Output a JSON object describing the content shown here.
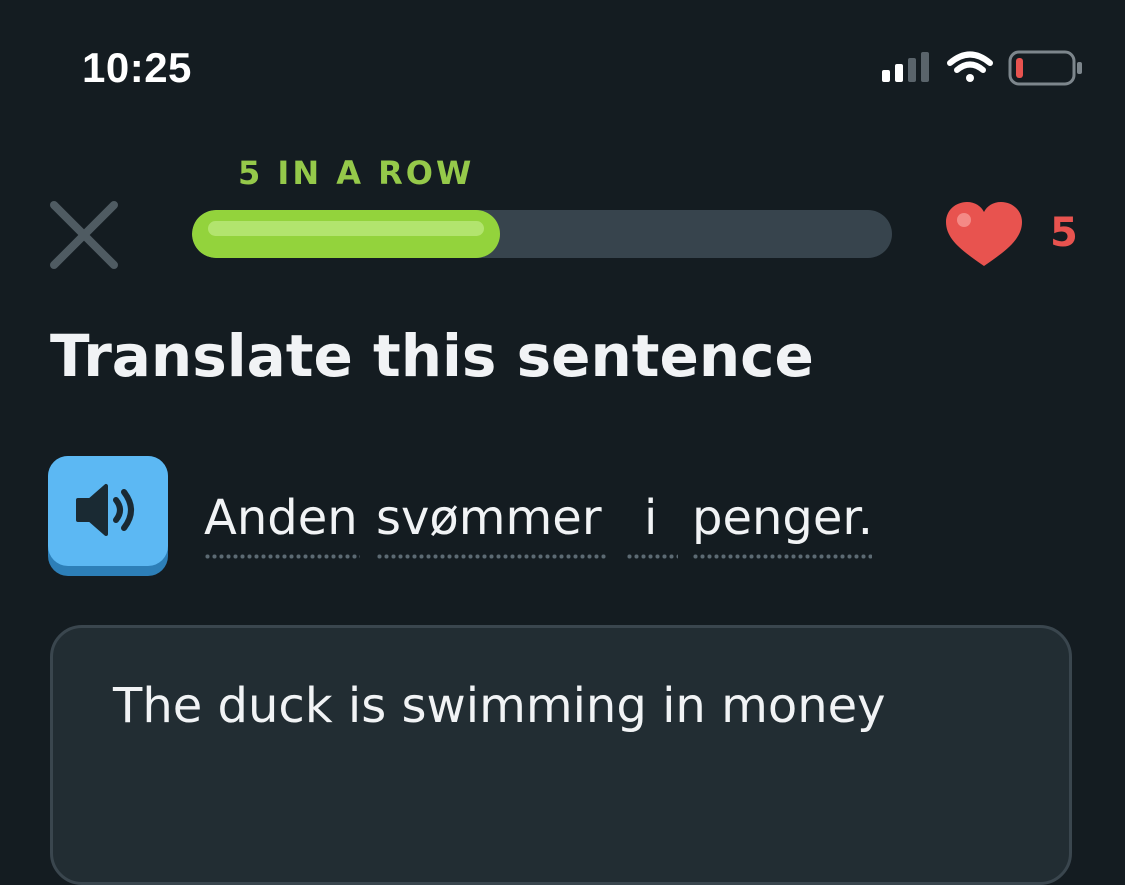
{
  "status_bar": {
    "time": "10:25",
    "icons": [
      "cellular-signal-icon",
      "wifi-icon",
      "battery-low-icon"
    ],
    "battery_color": "#e8534f"
  },
  "lesson": {
    "streak_label": "5 IN A ROW",
    "progress_fraction": 0.44,
    "hearts_count": "5",
    "progress_color": "#93d33c",
    "heart_color": "#e8534f"
  },
  "exercise": {
    "instruction": "Translate this sentence",
    "words": [
      "Anden",
      "svømmer",
      "i",
      "penger."
    ],
    "audio_icon": "speaker-icon"
  },
  "answer": {
    "value": "The duck is swimming in money"
  },
  "colors": {
    "background": "#141c21",
    "accent_blue": "#5cb8f3",
    "streak_green": "#95c94a"
  }
}
